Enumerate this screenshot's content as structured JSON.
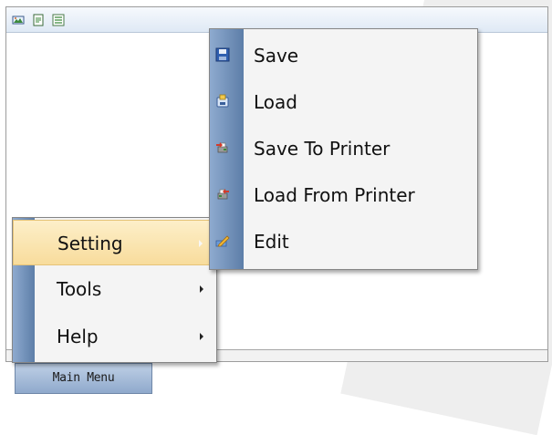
{
  "main_menu": {
    "label": "Main Menu",
    "items": [
      {
        "label": "Setting",
        "highlighted": true,
        "has_submenu": true
      },
      {
        "label": "Tools",
        "highlighted": false,
        "has_submenu": true
      },
      {
        "label": "Help",
        "highlighted": false,
        "has_submenu": true
      }
    ]
  },
  "setting_submenu": {
    "items": [
      {
        "label": "Save",
        "icon": "save-disk-icon"
      },
      {
        "label": "Load",
        "icon": "load-folder-icon"
      },
      {
        "label": "Save To Printer",
        "icon": "save-to-printer-icon"
      },
      {
        "label": "Load From Printer",
        "icon": "load-from-printer-icon"
      },
      {
        "label": "Edit",
        "icon": "edit-pencil-icon"
      }
    ]
  },
  "toolbar": {
    "icons": [
      "image-icon",
      "document-icon",
      "list-icon"
    ]
  },
  "colors": {
    "highlight": "#f8dc9c",
    "gutter": "#5d7ea8",
    "menu_background": "#f4f4f4"
  }
}
